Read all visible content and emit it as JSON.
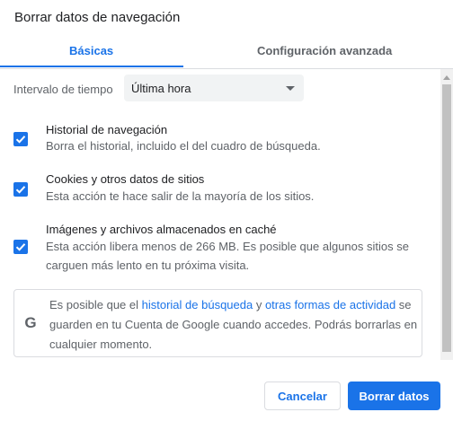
{
  "dialog": {
    "title": "Borrar datos de navegación"
  },
  "tabs": [
    {
      "label": "Básicas",
      "active": true
    },
    {
      "label": "Configuración avanzada",
      "active": false
    }
  ],
  "time_range": {
    "label": "Intervalo de tiempo",
    "selected": "Última hora"
  },
  "options": [
    {
      "title": "Historial de navegación",
      "description": "Borra el historial, incluido el del cuadro de búsqueda.",
      "checked": true
    },
    {
      "title": "Cookies y otros datos de sitios",
      "description": "Esta acción te hace salir de la mayoría de los sitios.",
      "checked": true
    },
    {
      "title": "Imágenes y archivos almacenados en caché",
      "description": "Esta acción libera menos de 266 MB. Es posible que algunos sitios se carguen más lento en tu próxima visita.",
      "checked": true
    }
  ],
  "info": {
    "icon": "google-g-icon",
    "text_before": "Es posible que el ",
    "link1": "historial de búsqueda",
    "text_middle": " y ",
    "link2": "otras formas de actividad",
    "text_after": " se guarden en tu Cuenta de Google cuando accedes. Podrás borrarlas en cualquier momento."
  },
  "buttons": {
    "cancel": "Cancelar",
    "clear": "Borrar datos"
  },
  "colors": {
    "accent": "#1a73e8",
    "text": "#202124",
    "secondary": "#5f6368"
  }
}
